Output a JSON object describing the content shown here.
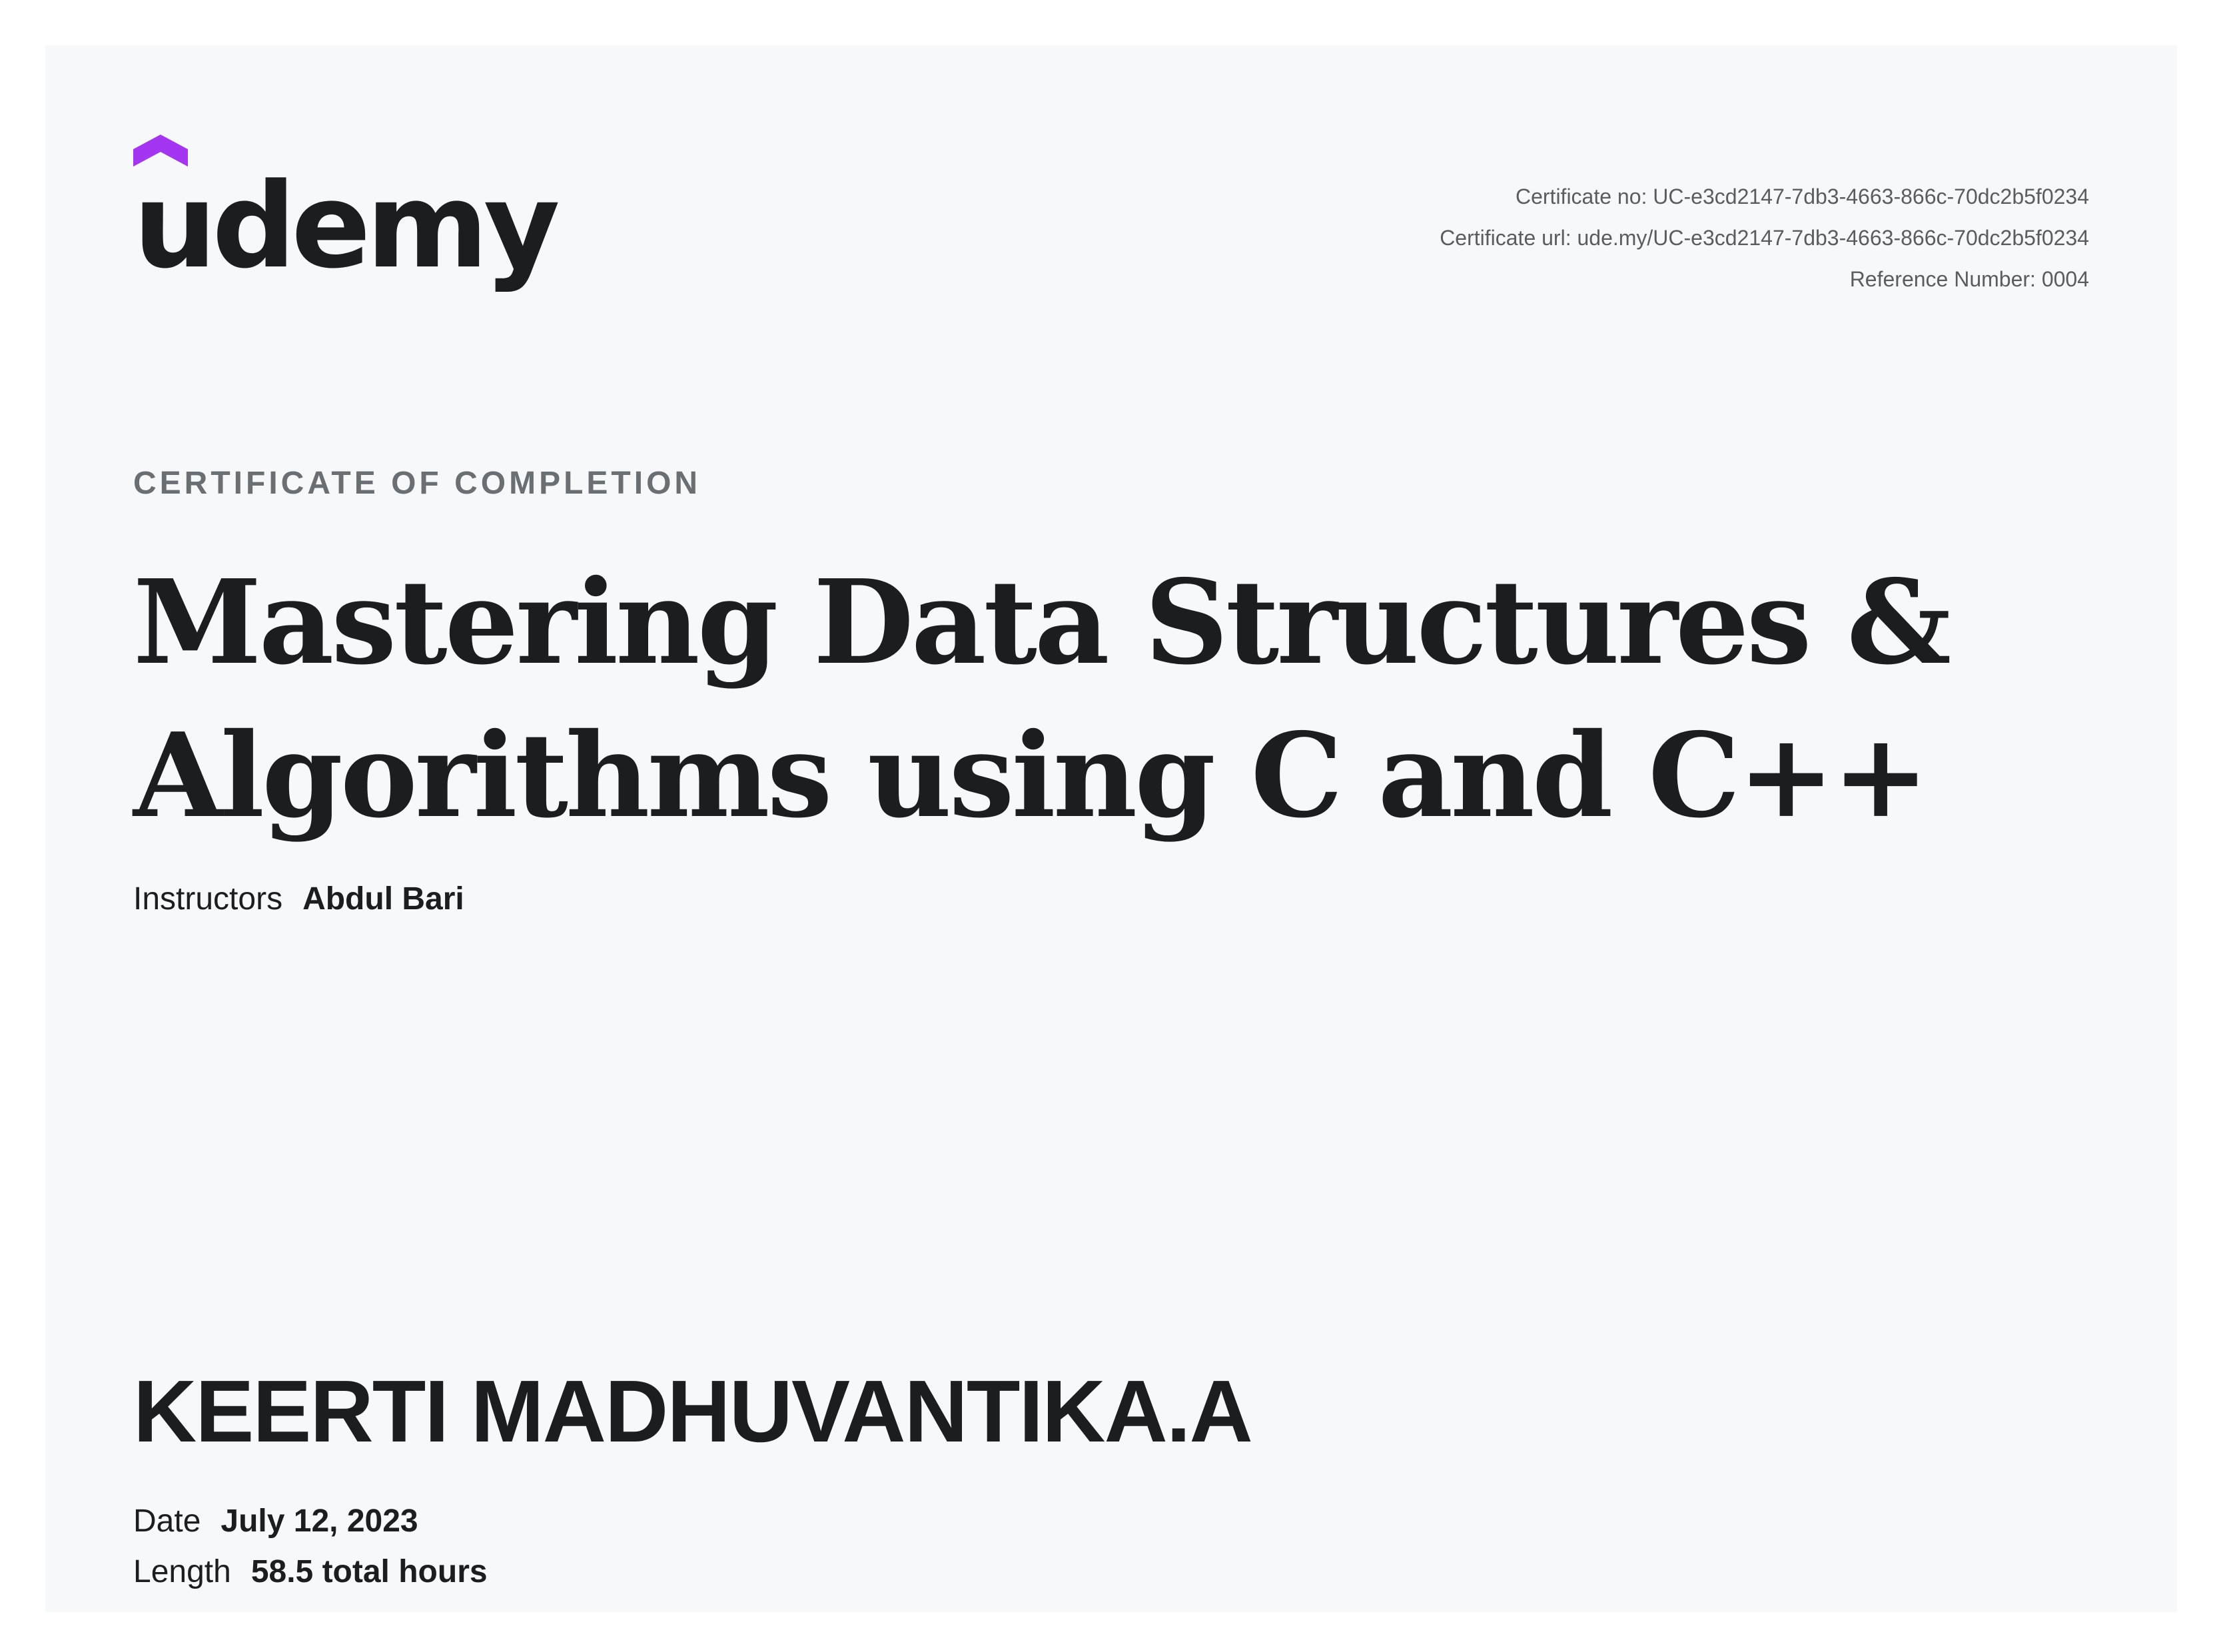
{
  "brand": {
    "logo_text": "udemy",
    "accent_color": "#a435f0",
    "text_color": "#1c1d1f"
  },
  "certificate_meta": {
    "number": "Certificate no: UC-e3cd2147-7db3-4663-866c-70dc2b5f0234",
    "url": "Certificate url: ude.my/UC-e3cd2147-7db3-4663-866c-70dc2b5f0234",
    "reference": "Reference Number: 0004"
  },
  "certificate": {
    "heading": "CERTIFICATE OF COMPLETION",
    "course_title": "Mastering Data Structures & Algorithms using C and C++",
    "instructors_label": "Instructors",
    "instructors_value": "Abdul Bari",
    "recipient_name": "KEERTI MADHUVANTIKA.A",
    "date_label": "Date",
    "date_value": "July 12, 2023",
    "length_label": "Length",
    "length_value": "58.5 total hours"
  }
}
